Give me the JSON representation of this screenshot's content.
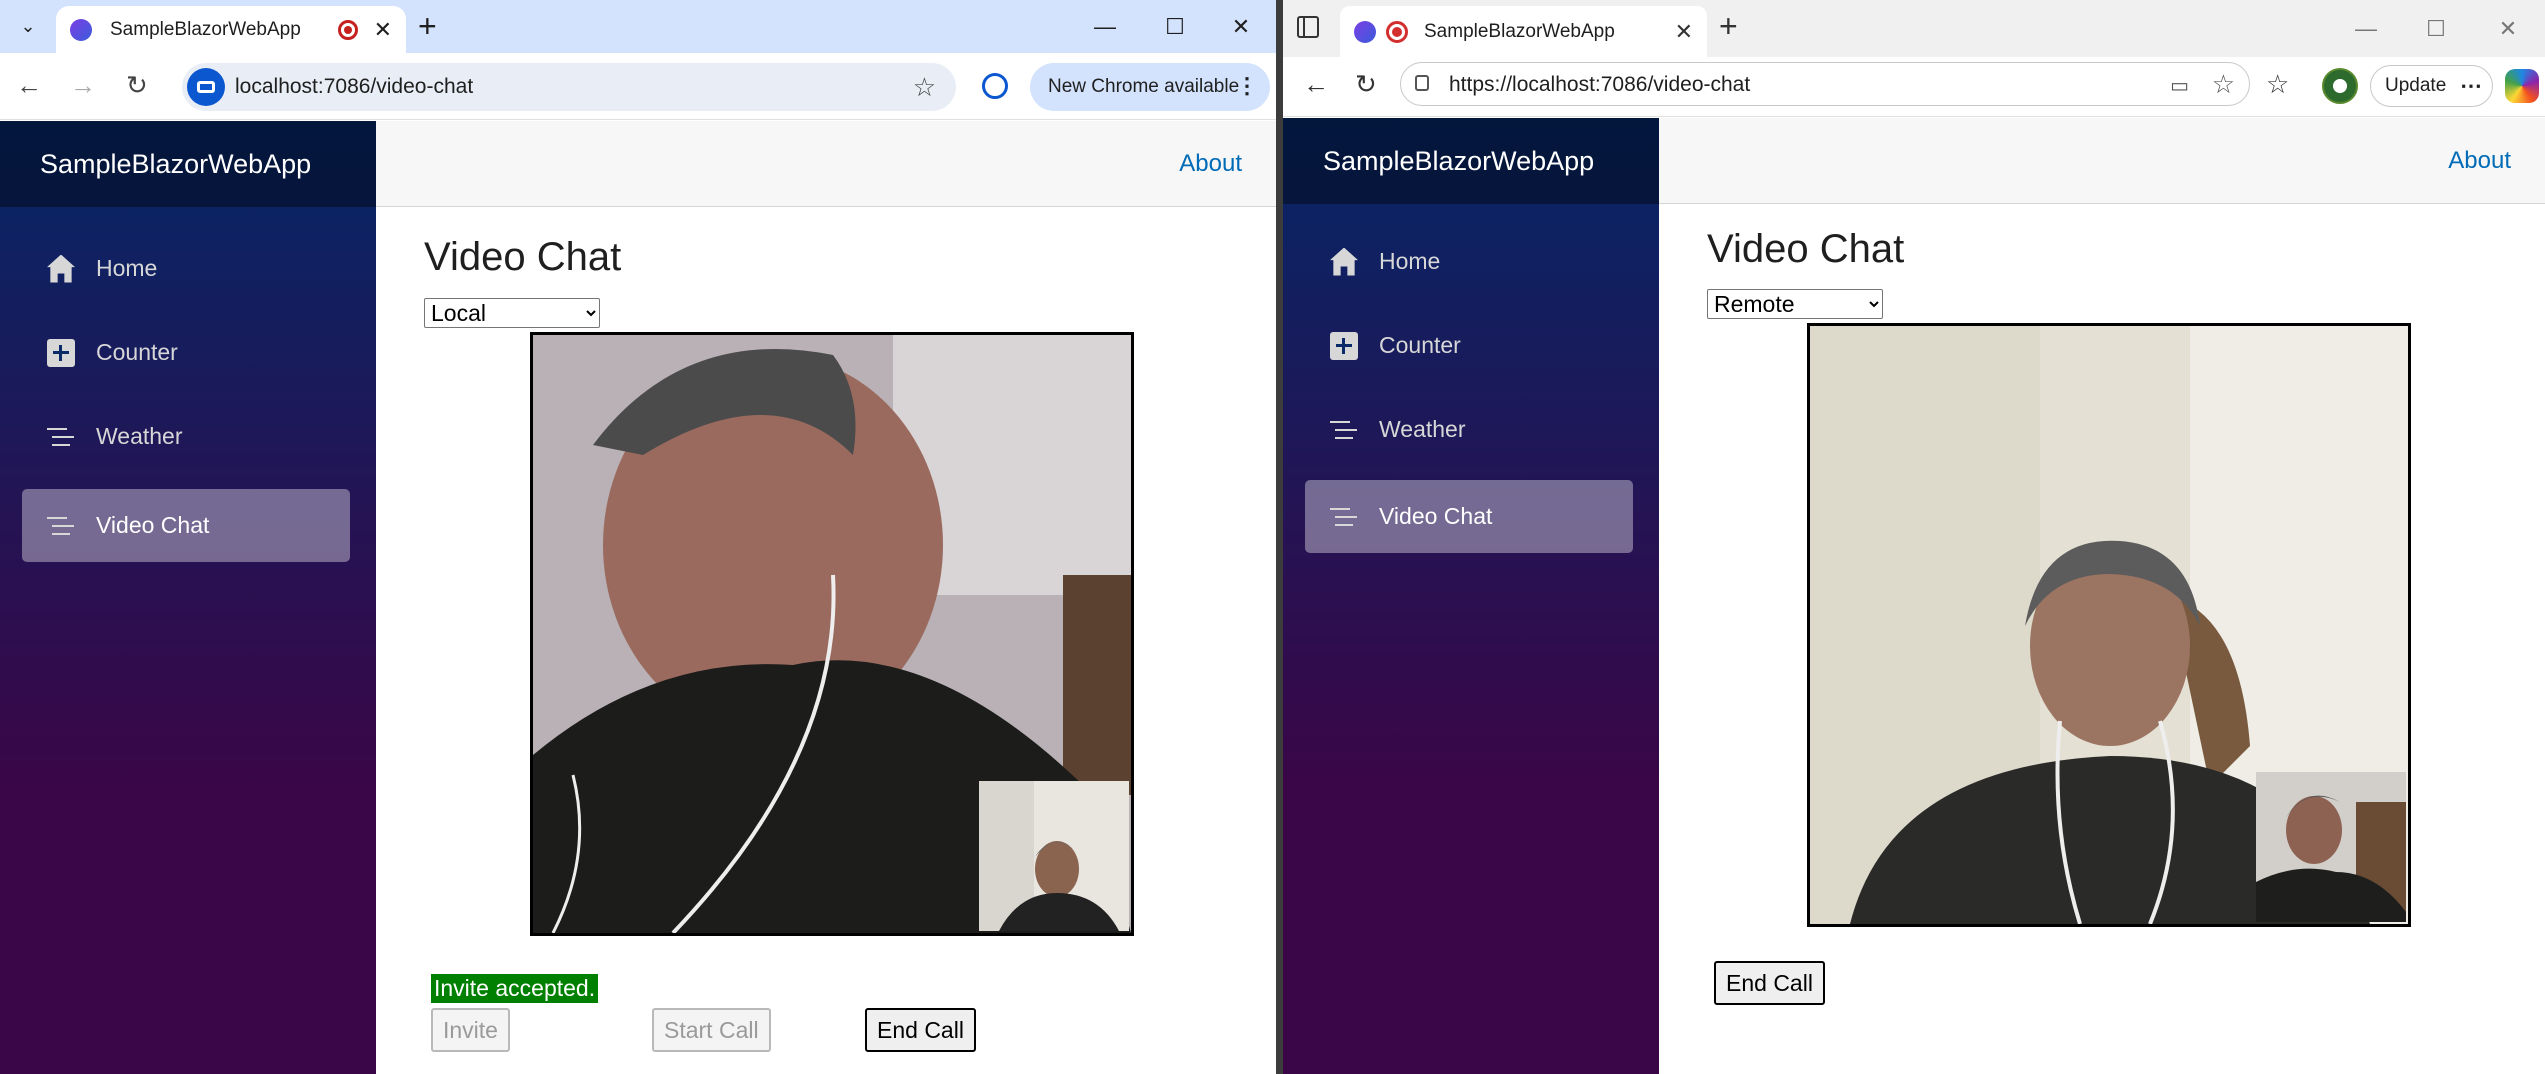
{
  "left_browser": {
    "tab_title": "SampleBlazorWebApp",
    "url": "localhost:7086/video-chat",
    "update_label": "New Chrome available"
  },
  "right_browser": {
    "tab_title": "SampleBlazorWebApp",
    "url": "https://localhost:7086/video-chat",
    "update_label": "Update"
  },
  "app": {
    "brand": "SampleBlazorWebApp",
    "about": "About",
    "nav": [
      {
        "label": "Home",
        "icon": "home-icon"
      },
      {
        "label": "Counter",
        "icon": "plus-square-icon"
      },
      {
        "label": "Weather",
        "icon": "list-icon"
      },
      {
        "label": "Video Chat",
        "icon": "list-icon"
      }
    ],
    "active_nav": "Video Chat",
    "page_title": "Video Chat"
  },
  "left_page": {
    "mode_selected": "Local",
    "status": "Invite accepted.",
    "invite_label": "Invite",
    "start_call_label": "Start Call",
    "end_call_label": "End Call"
  },
  "right_page": {
    "mode_selected": "Remote",
    "end_call_label": "End Call"
  },
  "colors": {
    "sidebar_top": "#052767",
    "sidebar_bottom": "#3a0647",
    "link": "#006bb7",
    "status_bg": "#008000"
  }
}
